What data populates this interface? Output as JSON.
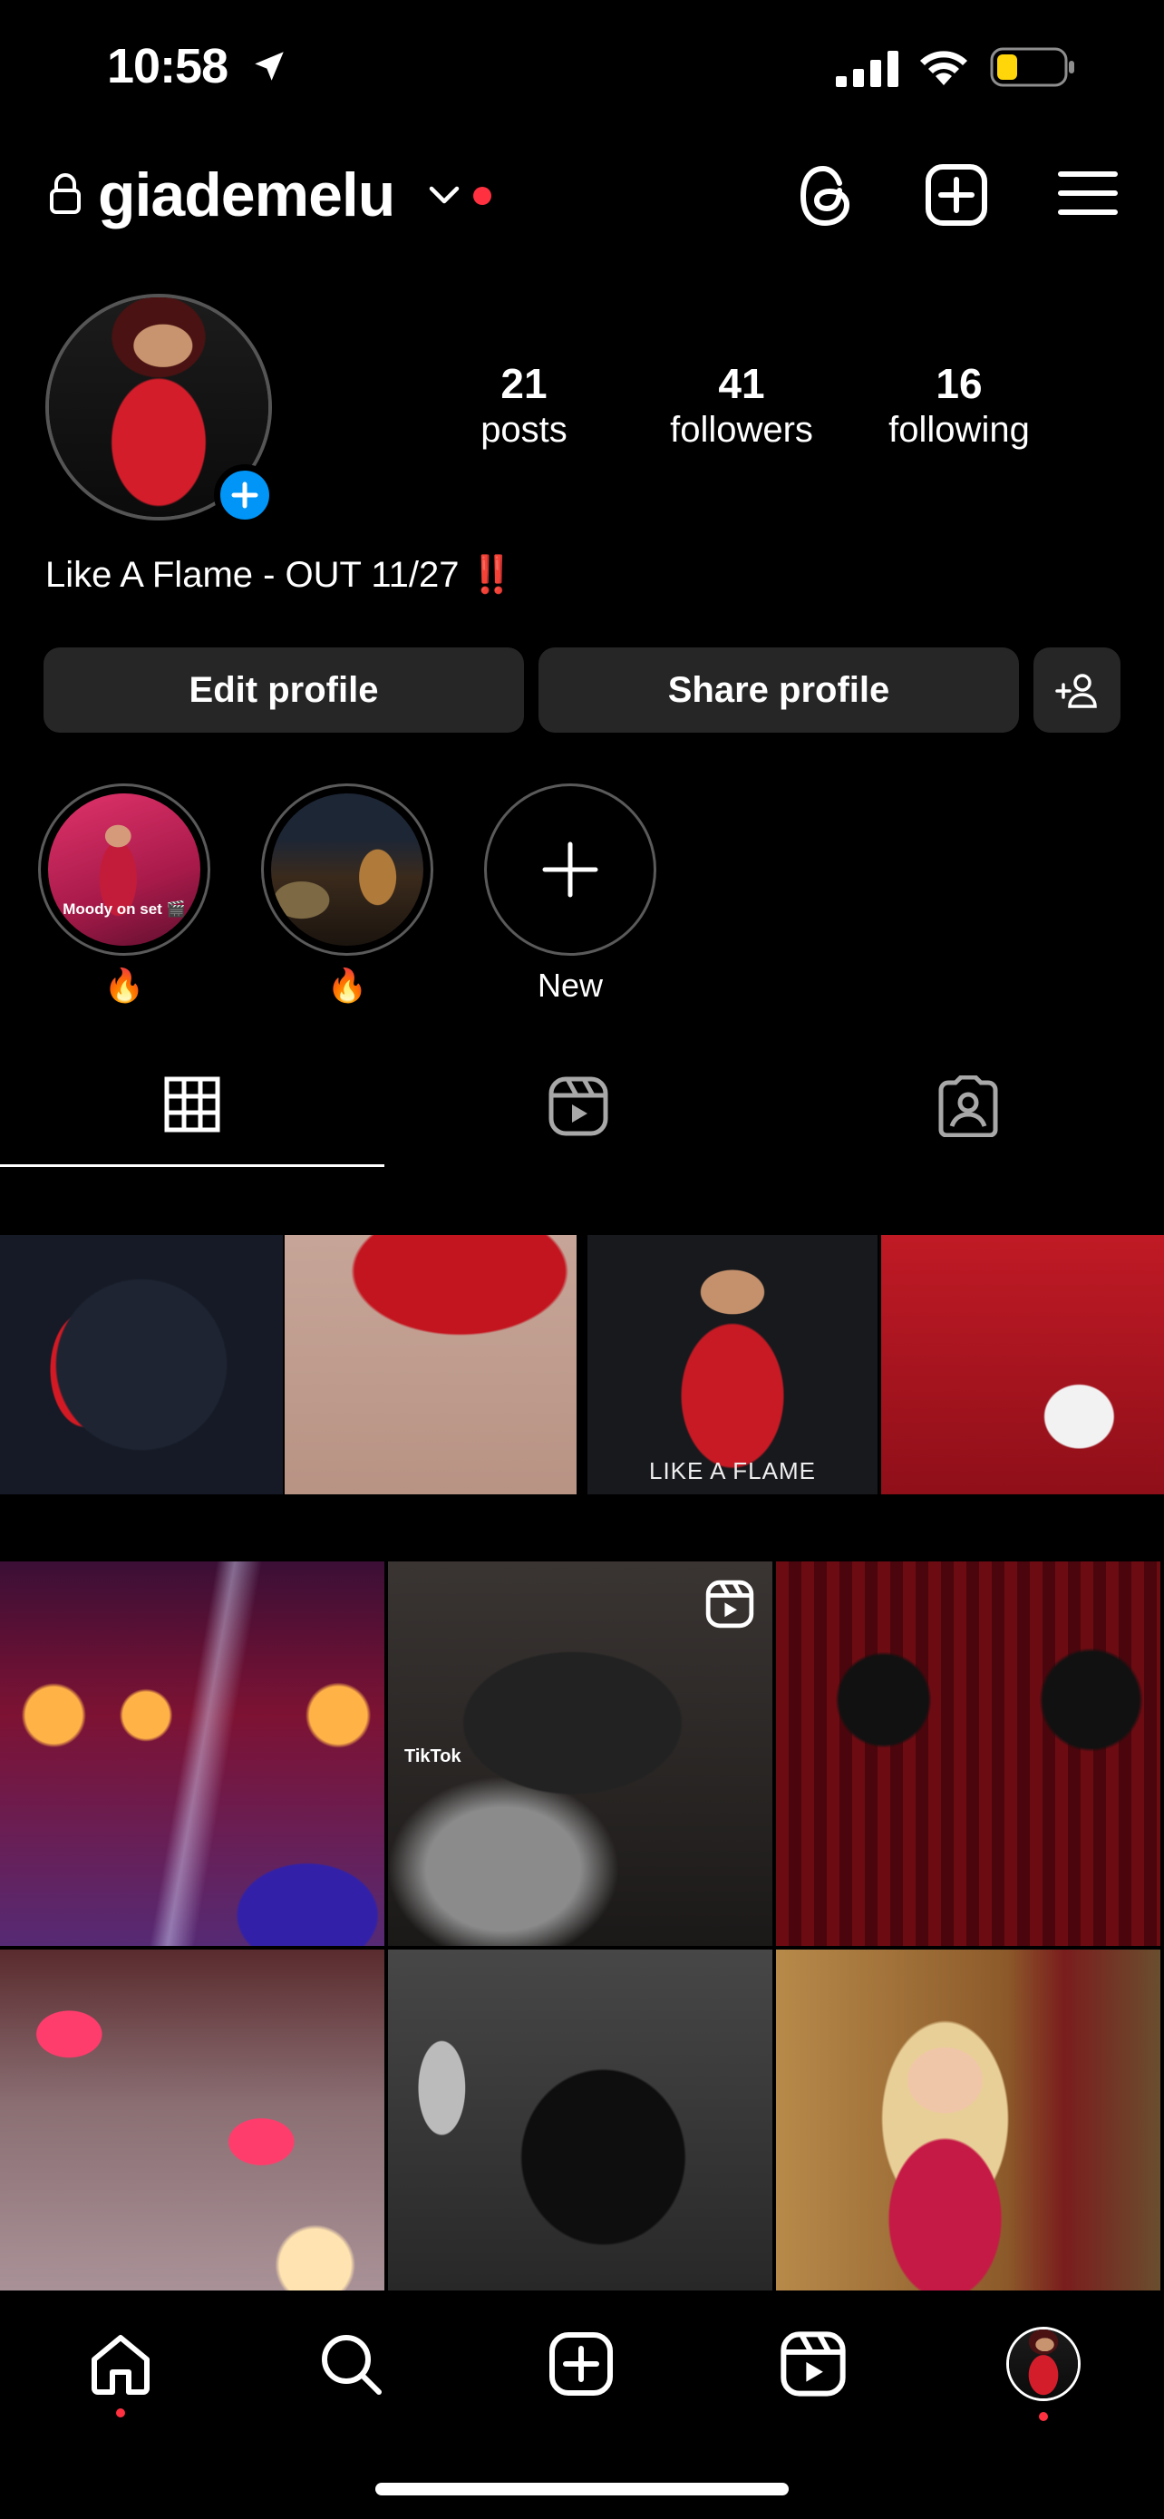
{
  "status_bar": {
    "time": "10:58"
  },
  "header": {
    "username": "giademelu"
  },
  "profile": {
    "stats": [
      {
        "value": "21",
        "label": "posts"
      },
      {
        "value": "41",
        "label": "followers"
      },
      {
        "value": "16",
        "label": "following"
      }
    ],
    "bio": "Like A Flame - OUT 11/27",
    "bio_mark": "‼️"
  },
  "actions": {
    "edit_label": "Edit profile",
    "share_label": "Share profile"
  },
  "highlights": [
    {
      "label": "🔥",
      "cover_text": "Moody on set 🎬"
    },
    {
      "label": "🔥"
    },
    {
      "label": "New"
    }
  ],
  "pinned": {
    "post3_text": "LIKE A FLAME"
  },
  "grid": {
    "tiktok_text": "TikTok"
  },
  "colors": {
    "accent_blue": "#0095f6",
    "notification_red": "#ff3040",
    "button_bg": "#262626"
  }
}
